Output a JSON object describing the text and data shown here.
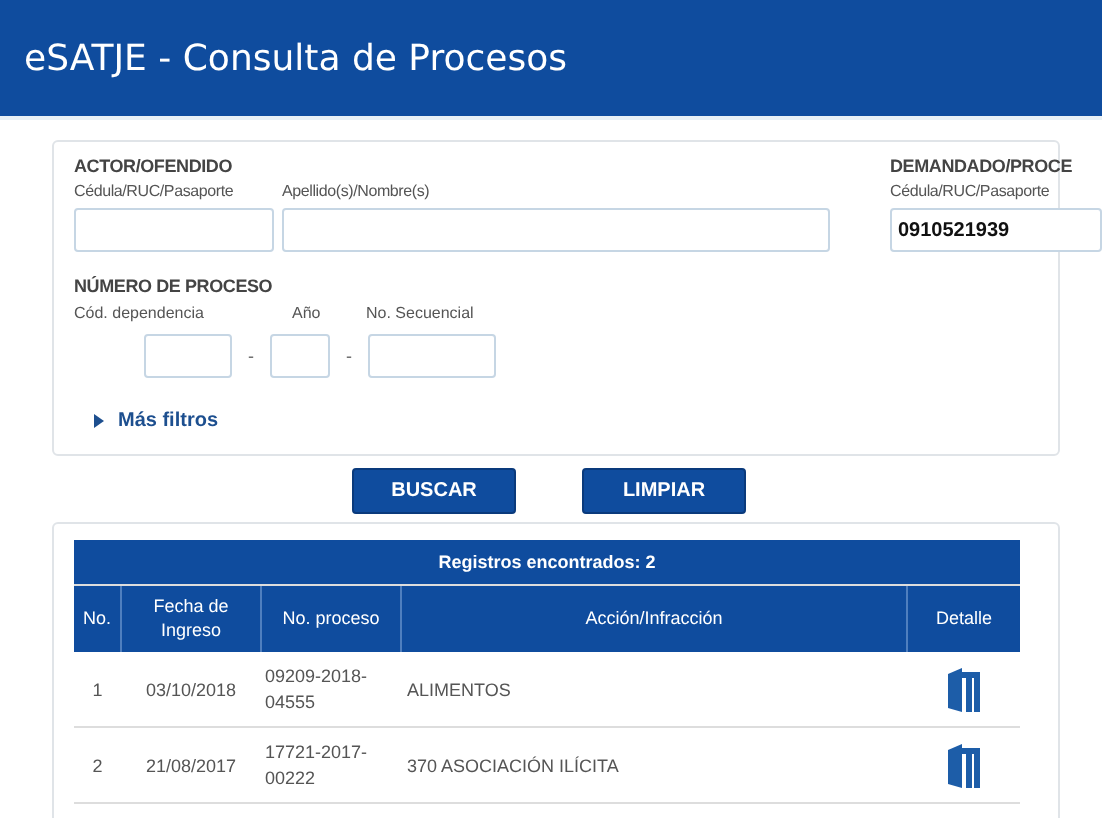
{
  "header": {
    "title": "eSATJE - Consulta de Procesos"
  },
  "actor": {
    "heading": "ACTOR/OFENDIDO",
    "fields": [
      {
        "label": "Cédula/RUC/Pasaporte"
      },
      {
        "label": "Apellido(s)/Nombre(s)"
      }
    ]
  },
  "demandado": {
    "heading": "DEMANDADO/PROCE",
    "fields": [
      {
        "label": "Cédula/RUC/Pasaporte",
        "value": "0910521939"
      }
    ]
  },
  "numero_proceso": {
    "heading": "NÚMERO DE PROCESO",
    "fields": [
      {
        "label": "Cód. dependencia"
      },
      {
        "label": "Año"
      },
      {
        "label": "No. Secuencial"
      }
    ],
    "separators": [
      "-",
      "-"
    ]
  },
  "more_filters": {
    "label": "Más filtros",
    "expanded": false
  },
  "buttons": [
    "BUSCAR",
    "LIMPIAR"
  ],
  "table": {
    "caption": "Registros encontrados: 2",
    "columns": [
      "No.",
      "Fecha de Ingreso",
      "No. proceso",
      "Acción/Infracción",
      "Detalle"
    ],
    "rows": [
      {
        "no": "1",
        "fecha": "03/10/2018",
        "proceso": "09209-2018-04555",
        "accion": "ALIMENTOS"
      },
      {
        "no": "2",
        "fecha": "21/08/2017",
        "proceso": "17721-2017-00222",
        "accion": "370 ASOCIACIÓN ILÍCITA"
      }
    ]
  }
}
